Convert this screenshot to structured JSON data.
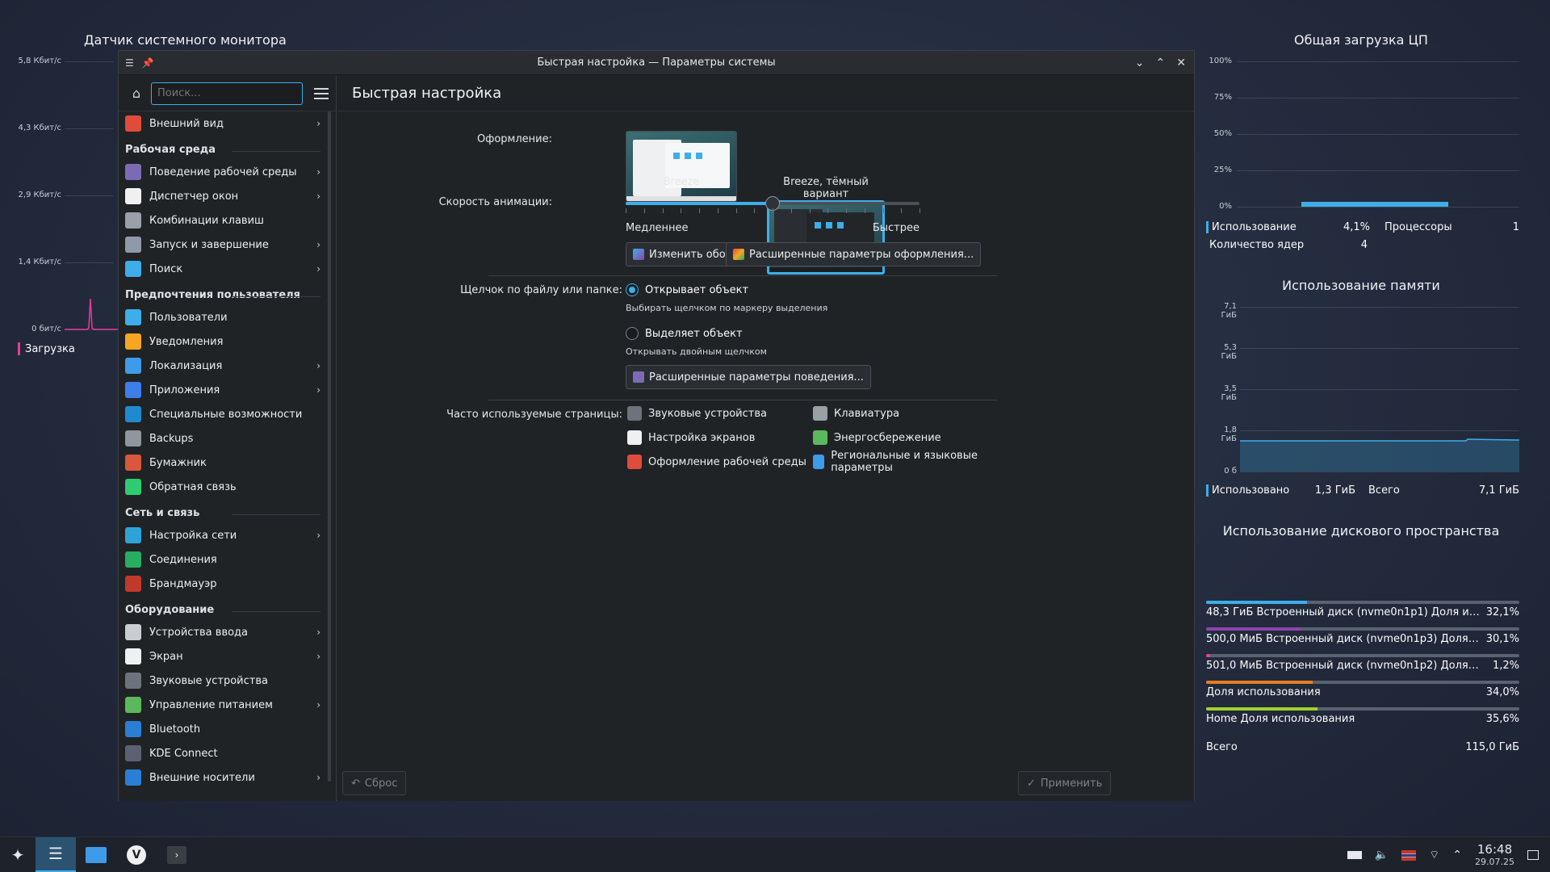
{
  "net_widget": {
    "title": "Датчик системного монитора",
    "ticks": [
      "5,8 Кбит/с",
      "4,3 Кбит/с",
      "2,9 Кбит/с",
      "1,4 Кбит/с",
      "0 бит/с"
    ],
    "legend": "Загрузка",
    "legend_color": "#e93a9a"
  },
  "cpu_widget": {
    "title": "Общая загрузка ЦП",
    "ticks": [
      "100%",
      "75%",
      "50%",
      "25%",
      "0%"
    ],
    "usage_label": "Использование",
    "usage_value": "4,1%",
    "usage_fraction": 0.041,
    "cpu_label": "Процессоры",
    "cpu_value": "1",
    "cores_label": "Количество ядер",
    "cores_value": "4",
    "accent": "#3daee9"
  },
  "mem_widget": {
    "title": "Использование памяти",
    "ticks": [
      "7,1 ГиБ",
      "5,3 ГиБ",
      "3,5 ГиБ",
      "1,8 ГиБ",
      "0 б"
    ],
    "used_label": "Использовано",
    "used_value": "1,3 ГиБ",
    "total_label": "Всего",
    "total_value": "7,1 ГиБ"
  },
  "disk_widget": {
    "title": "Использование дискового пространства",
    "rows": [
      {
        "name": "48,3 ГиБ Встроенный диск (nvme0n1p1) Доля испол...",
        "value": "32,1%",
        "fraction": 0.321,
        "color": "#3daee9"
      },
      {
        "name": "500,0 МиБ Встроенный диск (nvme0n1p3) Доля исполь...",
        "value": "30,1%",
        "fraction": 0.301,
        "color": "#8e44ad"
      },
      {
        "name": "501,0 МиБ Встроенный диск (nvme0n1p2) Доля испол...",
        "value": "1,2%",
        "fraction": 0.012,
        "color": "#e93a9a"
      },
      {
        "name": "Доля использования",
        "value": "34,0%",
        "fraction": 0.34,
        "color": "#e67e22"
      },
      {
        "name": "Home Доля использования",
        "value": "35,6%",
        "fraction": 0.356,
        "color": "#a0d12d"
      }
    ],
    "total_label": "Всего",
    "total_value": "115,0 ГиБ"
  },
  "window": {
    "title": "Быстрая настройка — Параметры системы",
    "search_placeholder": "Поиск...",
    "page_title": "Быстрая настройка"
  },
  "sidebar": {
    "top_item": {
      "label": "Внешний вид",
      "icon": "appearance-icon",
      "color": "#e04c3c"
    },
    "categories": [
      {
        "label": "Рабочая среда",
        "items": [
          {
            "label": "Поведение рабочей среды",
            "icon": "workspace-icon",
            "color": "#7c6bb4",
            "chevron": true
          },
          {
            "label": "Диспетчер окон",
            "icon": "window-icon",
            "color": "#eef0f2",
            "chevron": true
          },
          {
            "label": "Комбинации клавиш",
            "icon": "keyboard-icon",
            "color": "#9aa0a8",
            "chevron": false
          },
          {
            "label": "Запуск и завершение",
            "icon": "startup-icon",
            "color": "#8e9aa8",
            "chevron": true
          },
          {
            "label": "Поиск",
            "icon": "search-icon",
            "color": "#3daee9",
            "chevron": true
          }
        ]
      },
      {
        "label": "Предпочтения пользователя",
        "items": [
          {
            "label": "Пользователи",
            "icon": "users-icon",
            "color": "#3daee9",
            "chevron": false
          },
          {
            "label": "Уведомления",
            "icon": "bell-icon",
            "color": "#f6a623",
            "chevron": false
          },
          {
            "label": "Локализация",
            "icon": "locale-icon",
            "color": "#3d9be9",
            "chevron": true
          },
          {
            "label": "Приложения",
            "icon": "apps-icon",
            "color": "#3d7fe9",
            "chevron": true
          },
          {
            "label": "Специальные возможности",
            "icon": "accessibility-icon",
            "color": "#1f8ad0",
            "chevron": false
          },
          {
            "label": "Backups",
            "icon": "backup-icon",
            "color": "#8f969e",
            "chevron": false
          },
          {
            "label": "Бумажник",
            "icon": "wallet-icon",
            "color": "#d9573c",
            "chevron": false
          },
          {
            "label": "Обратная связь",
            "icon": "feedback-icon",
            "color": "#2ecc71",
            "chevron": false
          }
        ]
      },
      {
        "label": "Сеть и связь",
        "items": [
          {
            "label": "Настройка сети",
            "icon": "globe-icon",
            "color": "#2ea3d8",
            "chevron": true
          },
          {
            "label": "Соединения",
            "icon": "globe-icon",
            "color": "#27ae60",
            "chevron": false
          },
          {
            "label": "Брандмауэр",
            "icon": "firewall-icon",
            "color": "#c0392b",
            "chevron": false
          }
        ]
      },
      {
        "label": "Оборудование",
        "items": [
          {
            "label": "Устройства ввода",
            "icon": "mouse-icon",
            "color": "#c9ccd0",
            "chevron": true
          },
          {
            "label": "Экран",
            "icon": "monitor-icon",
            "color": "#eef0f2",
            "chevron": true
          },
          {
            "label": "Звуковые устройства",
            "icon": "speaker-icon",
            "color": "#6c737c",
            "chevron": false
          },
          {
            "label": "Управление питанием",
            "icon": "power-icon",
            "color": "#5cb85c",
            "chevron": true
          },
          {
            "label": "Bluetooth",
            "icon": "bluetooth-icon",
            "color": "#2a7fd4",
            "chevron": false
          },
          {
            "label": "KDE Connect",
            "icon": "phone-icon",
            "color": "#5a6170",
            "chevron": false
          },
          {
            "label": "Внешние носители",
            "icon": "usb-icon",
            "color": "#2a7fd4",
            "chevron": true
          }
        ]
      }
    ]
  },
  "quick": {
    "theme_label": "Оформление:",
    "theme_light": "Breeze",
    "theme_dark": "Breeze, тёмный вариант",
    "anim_label": "Скорость анимации:",
    "anim_slow": "Медленнее",
    "anim_fast": "Быстрее",
    "anim_fraction": 0.5,
    "btn_wallpaper": "Изменить обои...",
    "btn_appearance": "Расширенные параметры оформления...",
    "click_label": "Щелчок по файлу или папке:",
    "radio_open": "Открывает объект",
    "radio_open_hint": "Выбирать щелчком по маркеру выделения",
    "radio_select": "Выделяет объект",
    "radio_select_hint": "Открывать двойным щелчком",
    "btn_behavior": "Расширенные параметры поведения...",
    "frequent_label": "Часто используемые страницы:",
    "frequent": [
      {
        "label": "Звуковые устройства",
        "icon": "speaker-icon",
        "color": "#6c737c"
      },
      {
        "label": "Клавиатура",
        "icon": "keyboard-icon",
        "color": "#9aa0a8"
      },
      {
        "label": "Настройка экранов",
        "icon": "monitor-icon",
        "color": "#eef0f2"
      },
      {
        "label": "Энергосбережение",
        "icon": "power-icon",
        "color": "#5cb85c"
      },
      {
        "label": "Оформление рабочей среды",
        "icon": "appearance-icon",
        "color": "#e04c3c"
      },
      {
        "label": "Региональные и языковые параметры",
        "icon": "locale-icon",
        "color": "#3d9be9"
      }
    ],
    "reset": "Сброс",
    "apply": "Применить"
  },
  "taskbar": {
    "time": "16:48",
    "date": "29.07.25"
  }
}
